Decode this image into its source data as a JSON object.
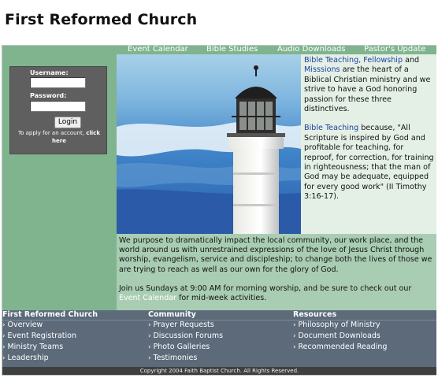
{
  "site": {
    "title": "First Reformed Church"
  },
  "nav": [
    "Event Calendar",
    "Bible Studies",
    "Audio Downloads",
    "Pastor's Update"
  ],
  "login": {
    "username_label": "Username:",
    "password_label": "Password:",
    "button_label": "Login",
    "apply_text": "To apply for an account,",
    "apply_link": "click here"
  },
  "side": {
    "p1_link1": "Bible Teaching, Fellowship",
    "p1_and": " and",
    "p1_link2": "Misssions",
    "p1_rest": " are the heart of a Biblical Christian ministry and we strive to have a God honoring passion for these three distinctives.",
    "p2_link": "Bible Teaching",
    "p2_rest": " because, \"All Scripture is inspired by God and profitable for teaching, for reproof, for correction, for training in righteousness; that the man of God may be adequate, equipped for every good work\" (II Timothy 3:16-17)."
  },
  "mission": {
    "p1": "We purpose to dramatically impact the local community, our work place, and the world around us with unrestrained expressions of the love of Jesus Christ through worship, evangelism, service and discipleship; to change both the lives of those we are trying to reach as well as our own for the glory of God.",
    "p2_a": "Join us Sundays at 9:00 AM for morning worship, and be sure to check out our ",
    "p2_link": "Event Calendar",
    "p2_b": " for mid-week activities."
  },
  "footer": {
    "col1": {
      "heading": "First Reformed Church",
      "items": [
        "Overview",
        "Event Registration",
        "Ministry Teams",
        "Leadership"
      ]
    },
    "col2": {
      "heading": "Community",
      "items": [
        "Prayer Requests",
        "Discussion Forums",
        "Photo Galleries",
        "Testimonies"
      ]
    },
    "col3": {
      "heading": "Resources",
      "items": [
        "Philosophy of Ministry",
        "Document Downloads",
        "Recommended Reading"
      ]
    },
    "copyright": "Copyright 2004 Faith Baptist Church. All Rights Reserved."
  },
  "colors": {
    "nav_green": "#7fb48f",
    "side_bg": "#e4f0e6",
    "mission_bg": "#a9cdb2",
    "footer_bg": "#5c6a7a",
    "link_blue": "#1f3f9f"
  }
}
